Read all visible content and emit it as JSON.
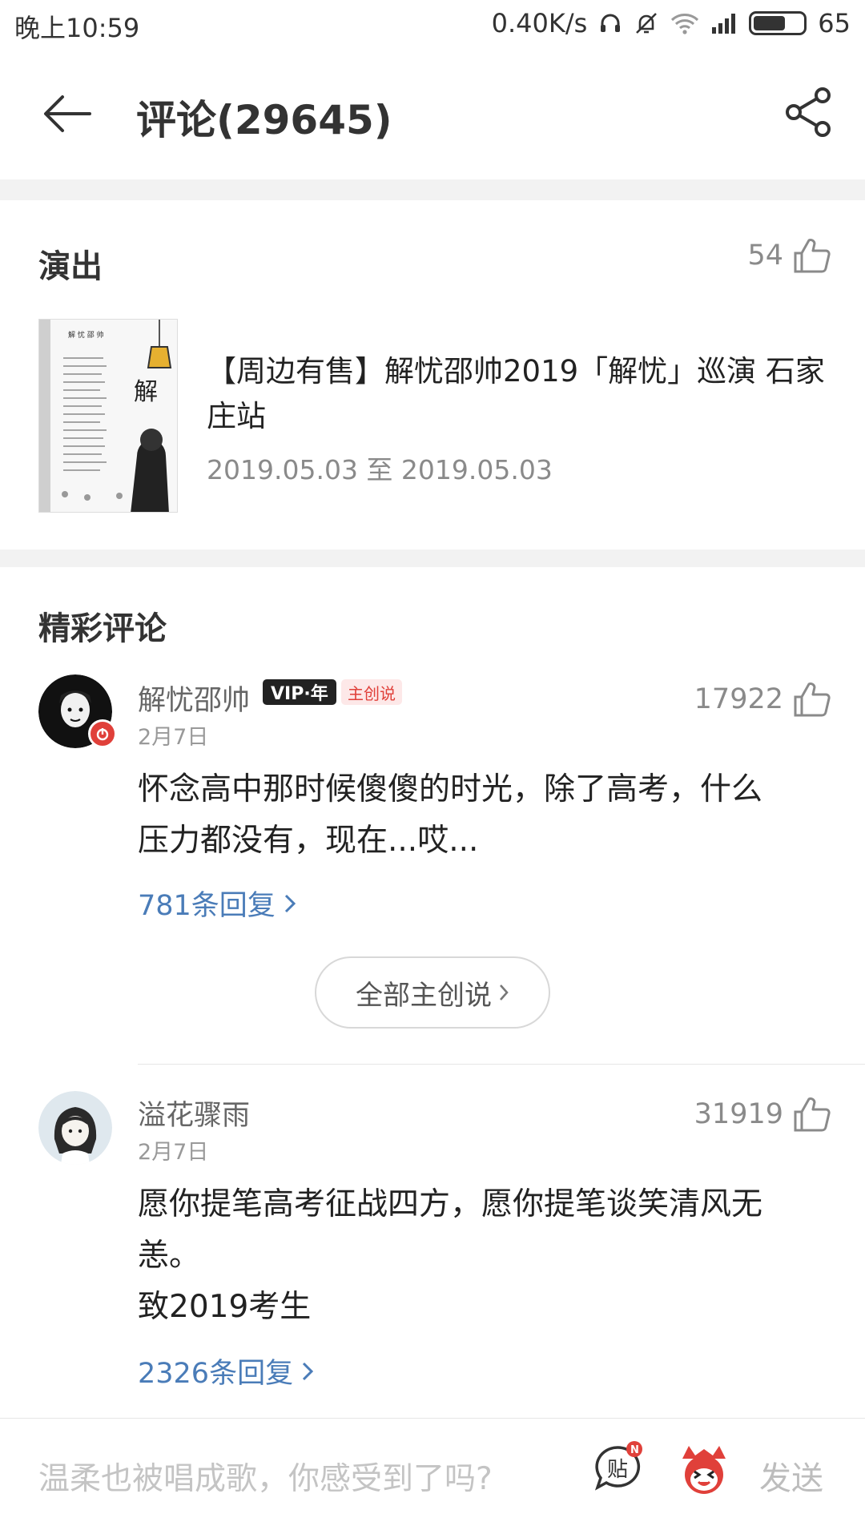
{
  "status_bar": {
    "time": "晚上10:59",
    "speed": "0.40K/s",
    "battery": "65",
    "battery_level": 0.65
  },
  "header": {
    "title": "评论(29645)",
    "back_icon": "arrow-left-icon",
    "share_icon": "share-icon"
  },
  "show_section": {
    "title": "演出",
    "like_count": "54",
    "show_title": "【周边有售】解忧邵帅2019「解忧」巡演 石家庄站",
    "show_date": "2019.05.03 至 2019.05.03",
    "poster_heading": "解 忧 邵 帅",
    "poster_big_char": "解"
  },
  "comments_section": {
    "title": "精彩评论",
    "comments": [
      {
        "user": "解忧邵帅",
        "vip_badge": "VIP·年",
        "creator_badge": "主创说",
        "date": "2月7日",
        "likes": "17922",
        "text": "怀念高中那时候傻傻的时光，除了高考，什么\n压力都没有，现在...哎...",
        "replies": "781条回复"
      },
      {
        "user": "溢花骤雨",
        "date": "2月7日",
        "likes": "31919",
        "text": "愿你提笔高考征战四方，愿你提笔谈笑清风无\n恙。\n致2019考生",
        "replies": "2326条回复"
      }
    ],
    "all_creator_button": "全部主创说"
  },
  "bottom_bar": {
    "placeholder": "温柔也被唱成歌，你感受到了吗?",
    "tie_label": "贴",
    "tie_badge": "N",
    "send": "发送"
  },
  "colors": {
    "link": "#4a7cb8",
    "accent_red": "#e0403a"
  }
}
